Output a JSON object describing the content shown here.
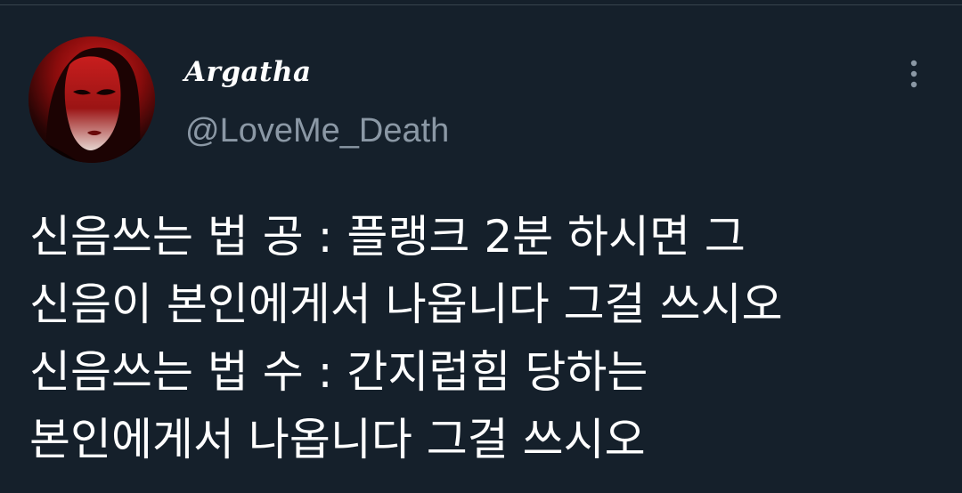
{
  "theme": {
    "background": "#15202b",
    "text_primary": "#ffffff",
    "text_secondary": "#8b98a5",
    "divider": "#38444d"
  },
  "tweet": {
    "author": {
      "display_name": "Argatha",
      "handle": "@LoveMe_Death",
      "avatar_icon": "profile-photo-red-portrait"
    },
    "more_icon": "more-vertical-icon",
    "lines": [
      "신음쓰는 법 공 : 플랭크 2분 하시면 그",
      "신음이 본인에게서 나옵니다 그걸 쓰시오",
      "신음쓰는 법 수 : 간지럽힘 당하는",
      "본인에게서 나옵니다 그걸 쓰시오"
    ]
  }
}
